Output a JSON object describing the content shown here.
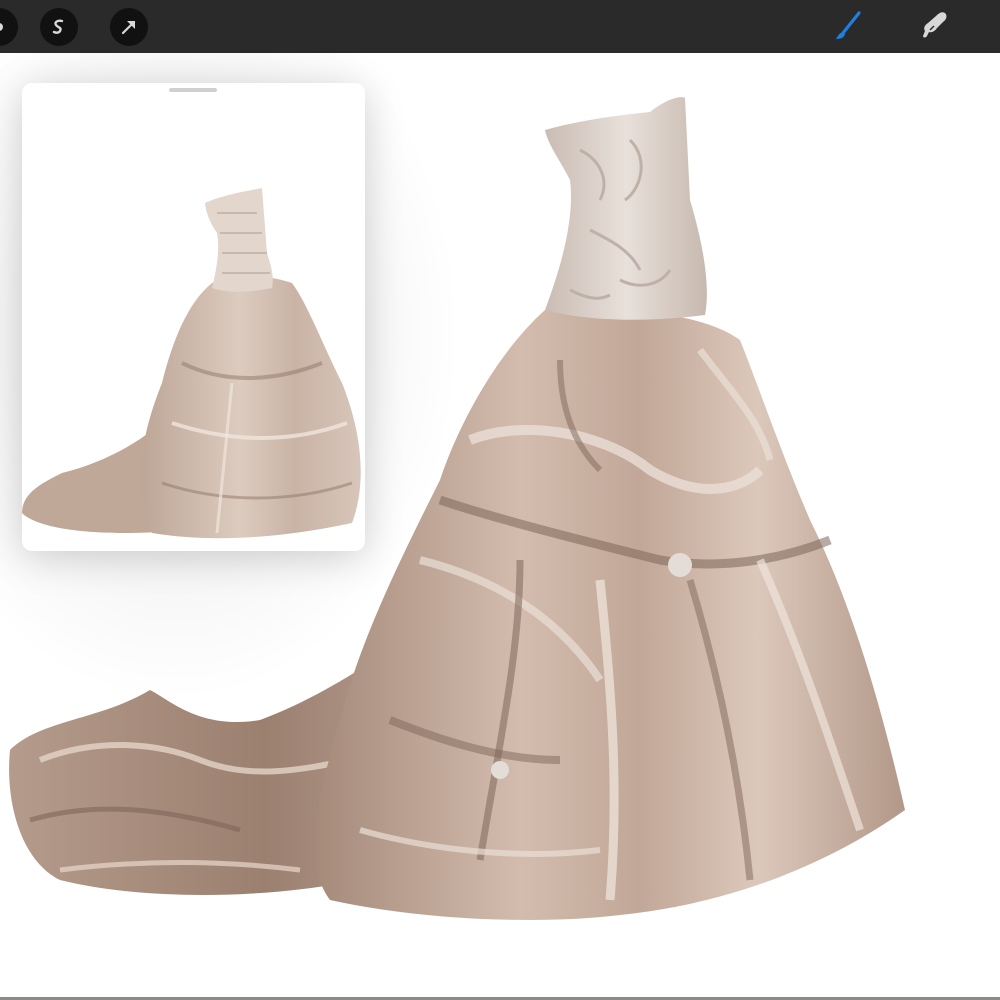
{
  "toolbar": {
    "left_tools": [
      {
        "name": "partial-tool-icon"
      },
      {
        "name": "selection-icon"
      },
      {
        "name": "transform-arrow-icon"
      }
    ],
    "right_tools": [
      {
        "name": "brush-icon",
        "active": true
      },
      {
        "name": "smudge-icon",
        "active": false
      }
    ],
    "colors": {
      "bar": "#2a2a2a",
      "button": "#111111",
      "active_tool": "#1e7fe0",
      "inactive_tool": "#d8d8d8"
    }
  },
  "reference": {
    "panel": "reference-panel",
    "image": "reference-dress-photo"
  },
  "canvas": {
    "artwork": "painted-wedding-dress",
    "colors": {
      "fabric": "#c7ae9f",
      "fabric_shadow": "#7e6658",
      "fabric_highlight": "#eadfd6",
      "lace": "#d9cfc8"
    }
  }
}
